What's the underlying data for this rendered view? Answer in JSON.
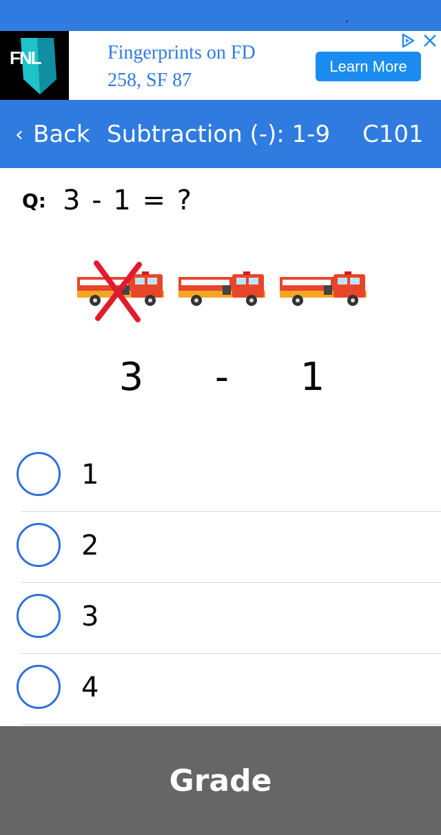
{
  "ad": {
    "brand": "FNL",
    "headline_line1": "Fingerprints on FD",
    "headline_line2": "258, SF 87",
    "cta": "Learn More",
    "choices_icon": "ad-choices-icon",
    "close_icon": "close-icon"
  },
  "nav": {
    "back_chevron": "‹",
    "back_label": "Back",
    "title": "Subtraction (-): 1-9",
    "code": "C101"
  },
  "question": {
    "prefix": "Q:",
    "text": "3 - 1 = ?"
  },
  "illustration": {
    "truck_count": 3,
    "crossed_out_count": 1,
    "expression_left": "3",
    "expression_op": "-",
    "expression_right": "1"
  },
  "options": [
    {
      "label": "1",
      "selected": false
    },
    {
      "label": "2",
      "selected": false
    },
    {
      "label": "3",
      "selected": false
    },
    {
      "label": "4",
      "selected": false
    }
  ],
  "footer": {
    "grade_label": "Grade"
  },
  "colors": {
    "primary": "#2f7be0",
    "radio_border": "#2f6fdc",
    "grade_bar": "#666666",
    "cross": "#e01b2c",
    "truck_red": "#e8452a",
    "truck_orange": "#f5a623"
  }
}
